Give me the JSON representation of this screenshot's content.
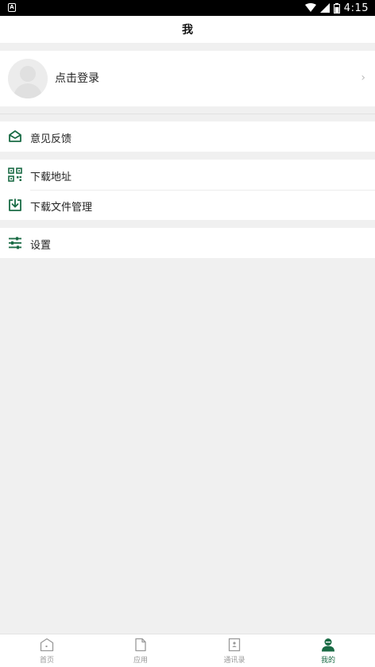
{
  "status_bar": {
    "time": "4:15"
  },
  "header": {
    "title": "我"
  },
  "profile": {
    "login_text": "点击登录"
  },
  "menu": {
    "feedback": "意见反馈",
    "download_address": "下载地址",
    "download_files": "下载文件管理",
    "settings": "设置"
  },
  "tabs": [
    {
      "label": "首页",
      "icon": "home-icon"
    },
    {
      "label": "应用",
      "icon": "document-icon"
    },
    {
      "label": "通讯录",
      "icon": "contacts-icon"
    },
    {
      "label": "我的",
      "icon": "person-icon"
    }
  ],
  "colors": {
    "accent": "#1a6b45",
    "inactive": "#999999"
  }
}
